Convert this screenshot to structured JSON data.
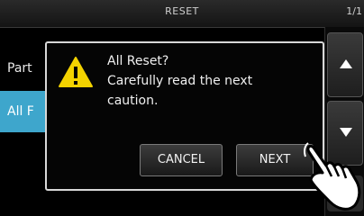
{
  "title": "RESET",
  "page_indicator": "1/1",
  "menu": {
    "items": [
      {
        "label": "Part"
      },
      {
        "label": "All F"
      }
    ]
  },
  "dialog": {
    "icon": "warning-icon",
    "lines": [
      "All Reset?",
      "Carefully read the next",
      "caution."
    ],
    "cancel_label": "CANCEL",
    "next_label": "NEXT"
  },
  "colors": {
    "selected_item": "#3ea6cc",
    "warning": "#f3d200"
  }
}
